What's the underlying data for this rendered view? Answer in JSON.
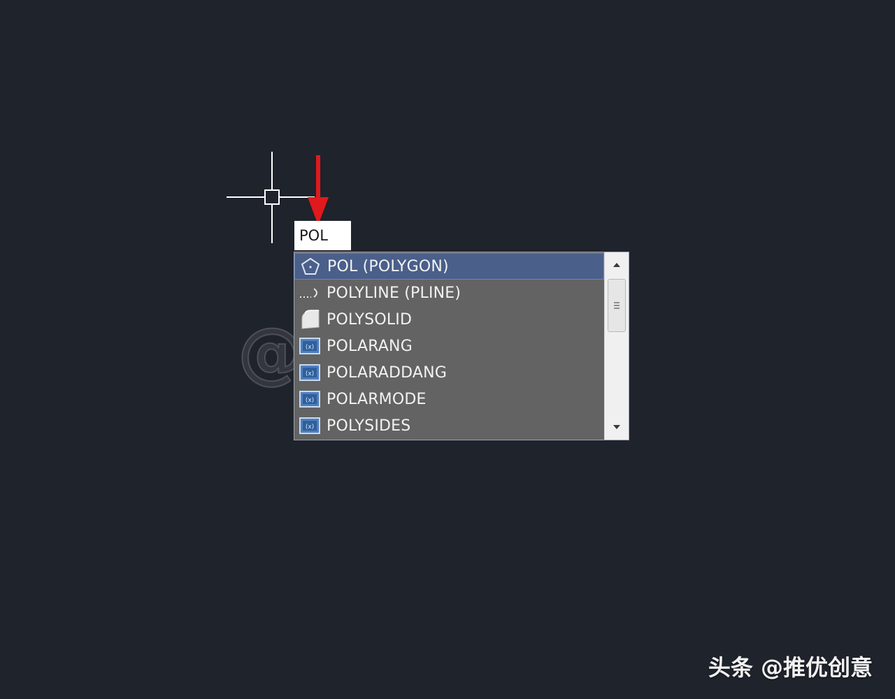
{
  "command_input": {
    "value": "POL"
  },
  "autocomplete": {
    "items": [
      {
        "label": "POL (POLYGON)",
        "icon": "polygon-icon",
        "selected": true
      },
      {
        "label": "POLYLINE (PLINE)",
        "icon": "polyline-icon",
        "selected": false
      },
      {
        "label": "POLYSOLID",
        "icon": "polysolid-icon",
        "selected": false
      },
      {
        "label": "POLARANG",
        "icon": "system-variable-icon",
        "selected": false
      },
      {
        "label": "POLARADDANG",
        "icon": "system-variable-icon",
        "selected": false
      },
      {
        "label": "POLARMODE",
        "icon": "system-variable-icon",
        "selected": false
      },
      {
        "label": "POLYSIDES",
        "icon": "system-variable-icon",
        "selected": false
      }
    ]
  },
  "watermark": {
    "text": "@推优创意"
  },
  "credit": {
    "text": "头条 @推优创意"
  },
  "colors": {
    "canvas_background": "#1f232c",
    "list_background": "#636363",
    "selected_background": "#4a5f8a",
    "arrow": "#e0191c"
  }
}
